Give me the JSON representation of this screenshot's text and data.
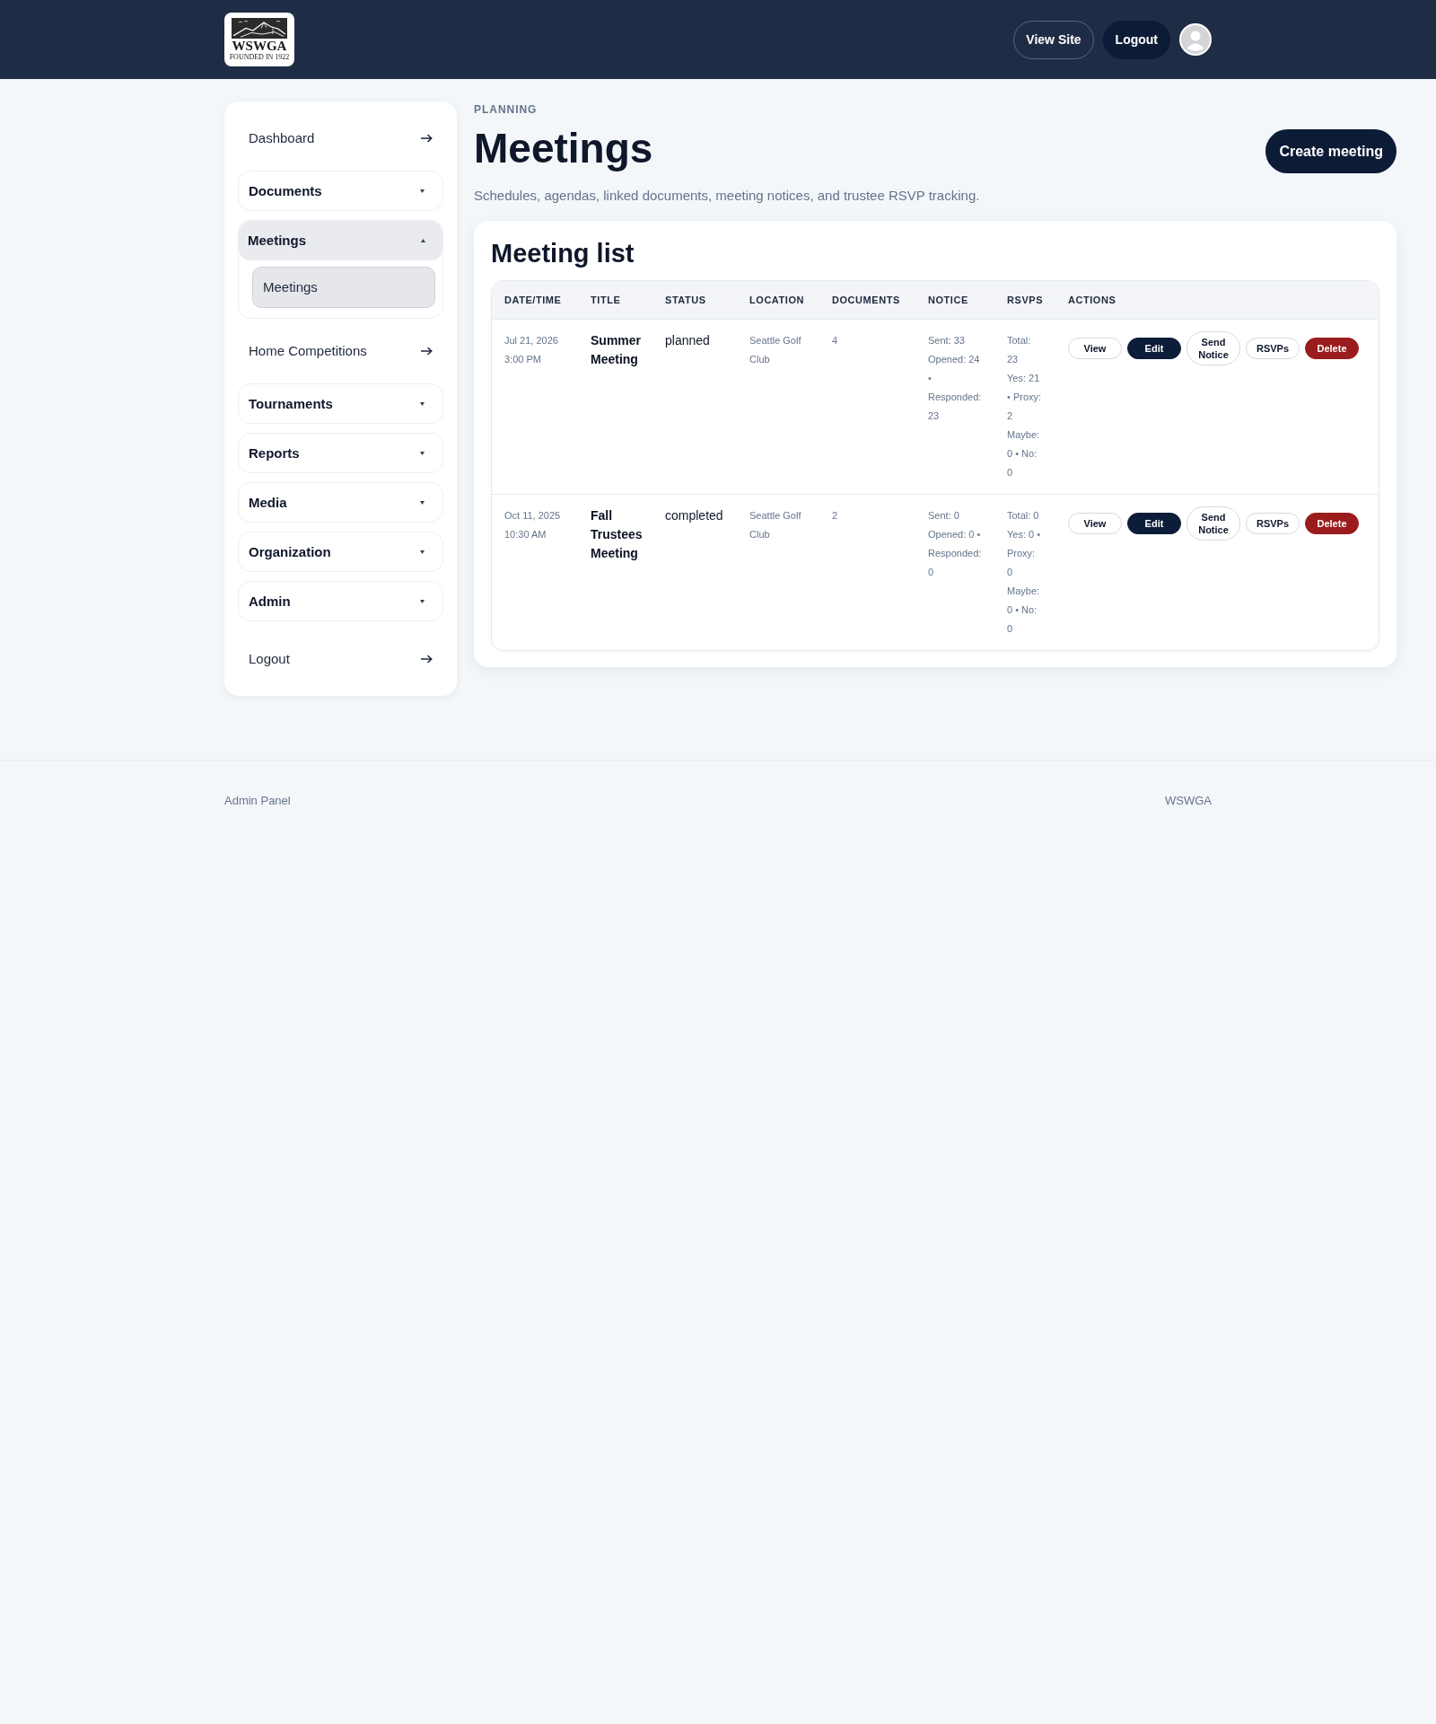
{
  "header": {
    "logo": {
      "wordmark": "WSWGA",
      "tagline": "FOUNDED IN 1922"
    },
    "buttons": [
      {
        "label": "View Site",
        "kind": "outline"
      },
      {
        "label": "Logout",
        "kind": "solid"
      }
    ]
  },
  "sidebar": {
    "items": [
      {
        "kind": "link",
        "label": "Dashboard"
      },
      {
        "kind": "group",
        "label": "Documents",
        "expanded": false
      },
      {
        "kind": "group",
        "label": "Meetings",
        "expanded": true,
        "children": [
          {
            "label": "Meetings",
            "selected": true
          }
        ]
      },
      {
        "kind": "link",
        "label": "Home Competitions"
      },
      {
        "kind": "group",
        "label": "Tournaments",
        "expanded": false
      },
      {
        "kind": "group",
        "label": "Reports",
        "expanded": false
      },
      {
        "kind": "group",
        "label": "Media",
        "expanded": false
      },
      {
        "kind": "group",
        "label": "Organization",
        "expanded": false
      },
      {
        "kind": "group",
        "label": "Admin",
        "expanded": false
      }
    ],
    "logout": {
      "label": "Logout"
    }
  },
  "page": {
    "eyebrow": "PLANNING",
    "title": "Meetings",
    "description": "Schedules, agendas, linked documents, meeting notices, and trustee RSVP tracking.",
    "action": "Create meeting"
  },
  "meeting_list": {
    "title": "Meeting list",
    "columns": [
      "DATE/TIME",
      "TITLE",
      "STATUS",
      "LOCATION",
      "DOCUMENTS",
      "NOTICE",
      "RSVPS",
      "ACTIONS"
    ],
    "rows": [
      {
        "date_time": "Jul 21, 2026 3:00 PM",
        "title": "Summer Meeting",
        "status": "planned",
        "location": "Seattle Golf Club",
        "documents": "4",
        "notice": [
          "Sent: 33",
          "Opened: 24 • Responded: 23"
        ],
        "rsvps": [
          "Total: 23",
          "Yes: 21 • Proxy: 2",
          "Maybe: 0 • No: 0"
        ],
        "actions": [
          {
            "label": "View",
            "kind": "outline"
          },
          {
            "label": "Edit",
            "kind": "primary"
          },
          {
            "label": "Send Notice",
            "kind": "outline"
          },
          {
            "label": "RSVPs",
            "kind": "outline"
          },
          {
            "label": "Delete",
            "kind": "danger"
          }
        ]
      },
      {
        "date_time": "Oct 11, 2025 10:30 AM",
        "title": "Fall Trustees Meeting",
        "status": "completed",
        "location": "Seattle Golf Club",
        "documents": "2",
        "notice": [
          "Sent: 0",
          "Opened: 0 • Responded: 0"
        ],
        "rsvps": [
          "Total: 0",
          "Yes: 0 • Proxy: 0",
          "Maybe: 0 • No: 0"
        ],
        "actions": [
          {
            "label": "View",
            "kind": "outline"
          },
          {
            "label": "Edit",
            "kind": "primary"
          },
          {
            "label": "Send Notice",
            "kind": "outline"
          },
          {
            "label": "RSVPs",
            "kind": "outline"
          },
          {
            "label": "Delete",
            "kind": "danger"
          }
        ]
      }
    ]
  },
  "footer": {
    "left": "Admin Panel",
    "right": "WSWGA"
  }
}
